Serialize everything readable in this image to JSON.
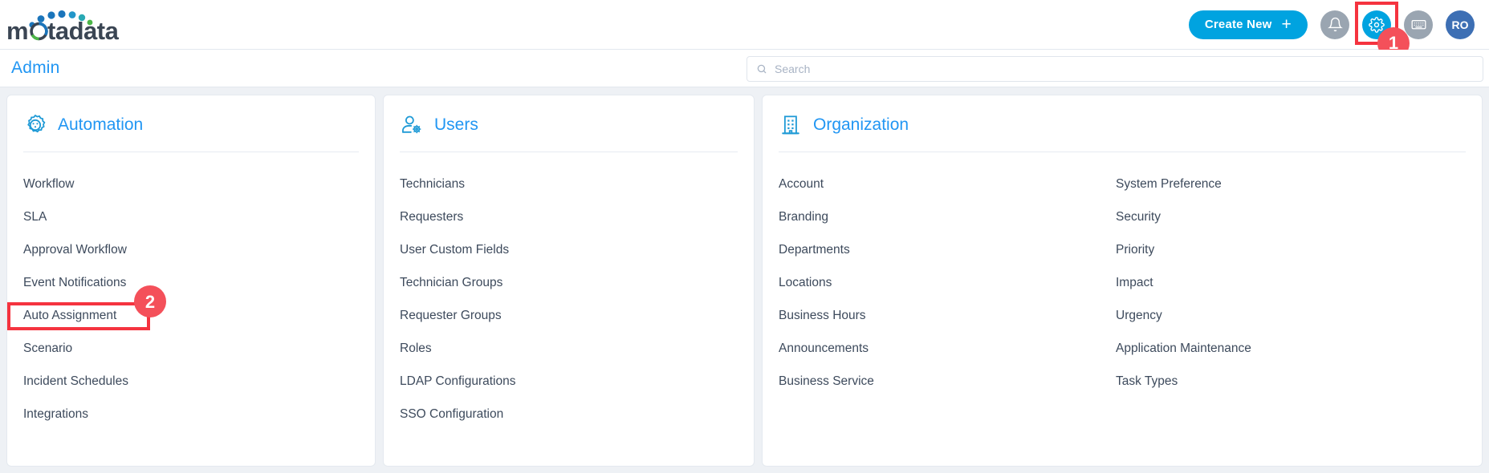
{
  "brand": {
    "name": "motadata"
  },
  "header": {
    "create_new_label": "Create New",
    "create_new_plus": "+",
    "icons": {
      "bell": "bell-icon",
      "gear": "gear-icon",
      "keyboard": "keyboard-icon"
    },
    "avatar_initials": "RO"
  },
  "annotations": {
    "step_one": "1",
    "step_two": "2",
    "highlight_color": "#f5333f",
    "badge_color": "#f4505a"
  },
  "subheader": {
    "title": "Admin",
    "search_placeholder": "Search"
  },
  "colors": {
    "accent_blue": "#2196f3",
    "brand_cyan": "#00a3e0",
    "avatar_blue": "#3d6fb4",
    "text_dark": "#3d4a5c"
  },
  "cards": [
    {
      "id": "automation",
      "title": "Automation",
      "icon": "automation-gear-icon",
      "items": [
        "Workflow",
        "SLA",
        "Approval Workflow",
        "Event Notifications",
        "Auto Assignment",
        "Scenario",
        "Incident Schedules",
        "Integrations"
      ]
    },
    {
      "id": "users",
      "title": "Users",
      "icon": "user-gear-icon",
      "items": [
        "Technicians",
        "Requesters",
        "User Custom Fields",
        "Technician Groups",
        "Requester Groups",
        "Roles",
        "LDAP Configurations",
        "SSO Configuration"
      ]
    },
    {
      "id": "organization",
      "title": "Organization",
      "icon": "building-icon",
      "items_col1": [
        "Account",
        "Branding",
        "Departments",
        "Locations",
        "Business Hours",
        "Announcements",
        "Business Service"
      ],
      "items_col2": [
        "System Preference",
        "Security",
        "Priority",
        "Impact",
        "Urgency",
        "Application Maintenance",
        "Task Types"
      ]
    }
  ]
}
